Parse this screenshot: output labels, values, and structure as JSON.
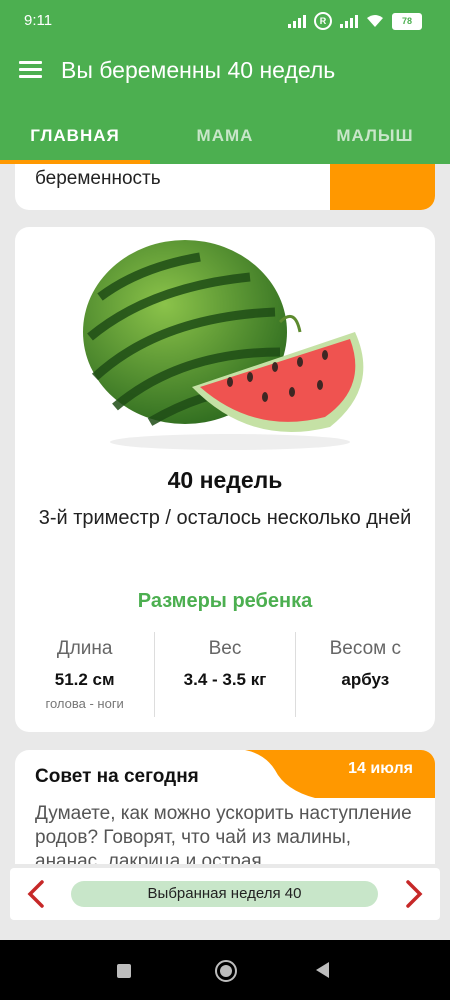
{
  "status_bar": {
    "time": "9:11",
    "battery": "78"
  },
  "app_bar": {
    "title": "Вы беременны 40 недель"
  },
  "tabs": [
    {
      "label": "ГЛАВНАЯ",
      "active": true
    },
    {
      "label": "МАМА",
      "active": false
    },
    {
      "label": "МАЛЫШ",
      "active": false
    }
  ],
  "top_card": {
    "text": "беременность"
  },
  "week_card": {
    "fruit_icon": "watermelon",
    "weeks": "40 недель",
    "trimester": "3-й триместр / осталось несколько дней",
    "sizes_title": "Размеры ребенка",
    "stats": [
      {
        "label": "Длина",
        "value": "51.2 см",
        "sub": "голова - ноги"
      },
      {
        "label": "Вес",
        "value": "3.4 - 3.5 кг",
        "sub": ""
      },
      {
        "label": "Весом с",
        "value": "арбуз",
        "sub": ""
      }
    ]
  },
  "advice_card": {
    "heading": "Совет на сегодня",
    "date": "14 июля",
    "body": "Думаете, как можно ускорить наступление родов? Говорят, что чай из малины, ананас, лакрица и острая"
  },
  "week_selector": {
    "label": "Выбранная неделя 40"
  },
  "colors": {
    "primary": "#4caf50",
    "accent": "#ff9800",
    "pill": "#c8e6c9"
  }
}
